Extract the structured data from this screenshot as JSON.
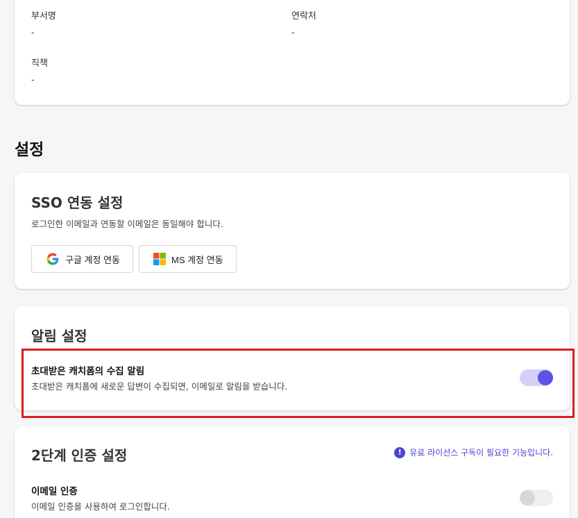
{
  "profile": {
    "department_label": "부서명",
    "department_value": "-",
    "contact_label": "연락처",
    "contact_value": "-",
    "position_label": "직책",
    "position_value": "-"
  },
  "settings": {
    "title": "설정",
    "sso": {
      "title": "SSO 연동 설정",
      "description": "로그인한 이메일과 연동할 이메일은 동일해야 합니다.",
      "google_button": "구글 계정 연동",
      "ms_button": "MS 계정 연동"
    },
    "notifications": {
      "title": "알림 설정",
      "item_title": "초대받은 캐치폼의 수집 알림",
      "item_description": "초대받은 캐치폼에 새로운 답변이 수집되면, 이메일로 알림을 받습니다.",
      "enabled": true
    },
    "two_factor": {
      "title": "2단계 인증 설정",
      "license_note": "유료 라이선스 구독이 필요한 기능입니다.",
      "info_icon_glyph": "!",
      "email_title": "이메일 인증",
      "email_description": "이메일 인증을 사용하여 로그인합니다.",
      "email_enabled": false
    }
  },
  "colors": {
    "accent": "#5b52e6",
    "accent_light": "#d4d1f7",
    "highlight": "#d81e1e",
    "license_text": "#4b43d6"
  }
}
